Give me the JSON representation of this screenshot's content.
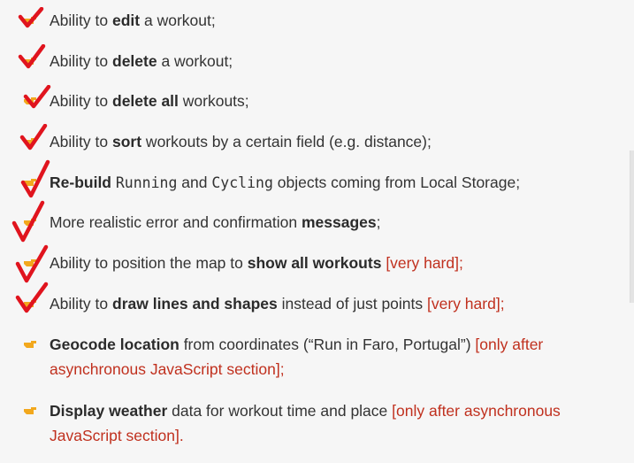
{
  "items": [
    {
      "p1": "Ability to ",
      "b1": "edit",
      "p2": " a workout;"
    },
    {
      "p1": "Ability to ",
      "b1": "delete",
      "p2": " a workout;"
    },
    {
      "p1": "Ability to ",
      "b1": "delete all",
      "p2": " workouts;"
    },
    {
      "p1": "Ability to ",
      "b1": "sort",
      "p2": " workouts by a certain field (e.g. distance);"
    },
    {
      "b1": "Re-build",
      "p1": " ",
      "c1": "Running",
      "p2": " and ",
      "c2": "Cycling",
      "p3": " objects coming from Local Storage;"
    },
    {
      "p1": "More realistic error and confirmation ",
      "b1": "messages",
      "p2": ";"
    },
    {
      "p1": "Ability to position the map to ",
      "b1": "show all workouts",
      "p2": " ",
      "n1": "[very hard];"
    },
    {
      "p1": "Ability to ",
      "b1": "draw lines and shapes",
      "p2": " instead of just points ",
      "n1": "[very hard];"
    },
    {
      "b1": "Geocode location",
      "p1": " from coordinates (“Run in Faro, Portugal”) ",
      "n1": "[only after asynchronous JavaScript section];"
    },
    {
      "b1": "Display weather",
      "p1": " data for workout time and place  ",
      "n1": "[only after asynchronous JavaScript section]."
    }
  ],
  "colors": {
    "text": "#333333",
    "note": "#c0301e",
    "bullet": "#f2a81d",
    "checkmark": "#e0141e",
    "background": "#f6f6f6"
  },
  "icons": {
    "bullet": "pointing-hand-icon",
    "check": "red-checkmark-icon"
  }
}
